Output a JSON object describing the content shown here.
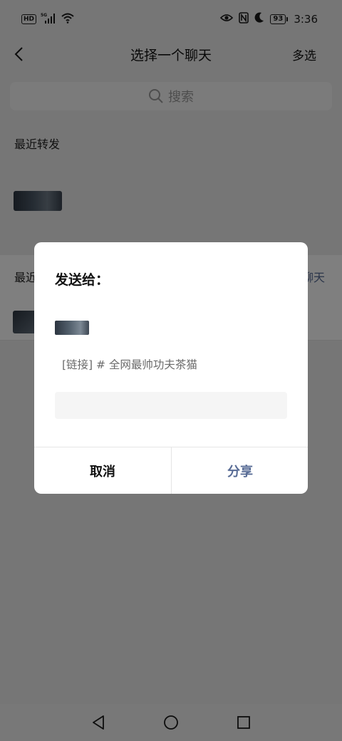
{
  "status_bar": {
    "hd_badge": "HD",
    "network_type": "5G",
    "battery_level": "93",
    "time": "3:36",
    "icons": [
      "hd-icon",
      "signal-5g-icon",
      "wifi-icon",
      "eye-icon",
      "nfc-icon",
      "moon-icon",
      "battery-icon"
    ]
  },
  "header": {
    "title": "选择一个聊天",
    "multi_select_label": "多选",
    "back_icon": "chevron-left-icon"
  },
  "search": {
    "placeholder": "搜索",
    "icon": "search-icon"
  },
  "recent_forward": {
    "label": "最近转发"
  },
  "recent_chats": {
    "label_visible": "最近",
    "create_link_visible": "聊天"
  },
  "dialog": {
    "title": "发送给：",
    "link_preview": "[链接] # 全网最帅功夫茶猫",
    "message_value": "",
    "cancel_label": "取消",
    "share_label": "分享"
  },
  "nav_bar": {
    "icons": [
      "nav-back-icon",
      "nav-home-icon",
      "nav-recent-icon"
    ]
  },
  "colors": {
    "accent_link": "#576b95",
    "overlay": "rgba(0,0,0,0.5)",
    "dialog_bg": "#ffffff"
  }
}
